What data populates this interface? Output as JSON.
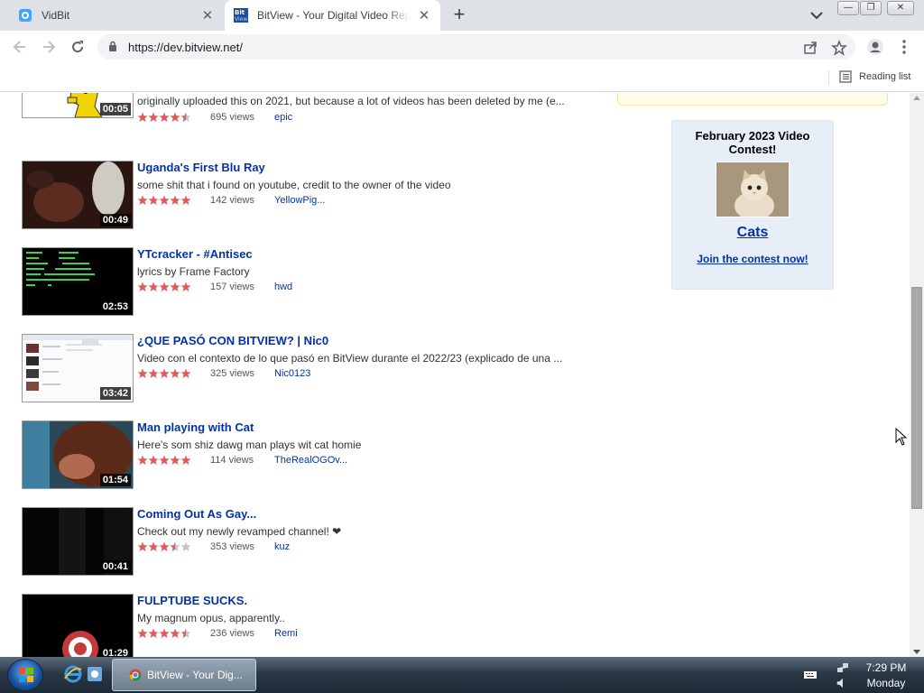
{
  "browser": {
    "tabs": [
      {
        "title": "VidBit",
        "active": false
      },
      {
        "title": "BitView - Your Digital Video Repository",
        "active": true
      }
    ],
    "url": "https://dev.bitview.net/",
    "reading_list_label": "Reading list",
    "icons": {
      "back": "arrow-left-icon",
      "forward": "arrow-right-icon",
      "reload": "reload-icon",
      "lock": "lock-icon",
      "share": "share-icon",
      "bookmark": "star-outline-icon",
      "profile": "avatar-icon",
      "menu": "kebab-menu-icon"
    }
  },
  "partial_video": {
    "description": "originally uploaded this on 2021, but because a lot of videos has been deleted by me (e...",
    "duration": "00:05",
    "views": "695 views",
    "author": "epic",
    "rating": 4.5
  },
  "videos": [
    {
      "title": "Uganda's First Blu Ray",
      "description": "some shit that i found on youtube, credit to the owner of the video",
      "duration": "00:49",
      "views": "142 views",
      "author": "YellowPig...",
      "rating": 5
    },
    {
      "title": "YTcracker - #Antisec",
      "description": "lyrics by Frame Factory",
      "duration": "02:53",
      "views": "157 views",
      "author": "hwd",
      "rating": 5
    },
    {
      "title": "¿QUE PASÓ CON BITVIEW? | Nic0",
      "description": "Video con el contexto de lo que pasó en BitView durante el 2022/23 (explicado de una ...",
      "duration": "03:42",
      "views": "325 views",
      "author": "Nic0123",
      "rating": 5
    },
    {
      "title": "Man playing with Cat",
      "description": "Here's som shiz dawg man plays wit cat homie",
      "duration": "01:54",
      "views": "114 views",
      "author": "TheRealOGOv...",
      "rating": 5
    },
    {
      "title": "Coming Out As Gay...",
      "description": "Check out my newly revamped channel! ❤",
      "duration": "00:41",
      "views": "353 views",
      "author": "kuz",
      "rating": 3.5
    },
    {
      "title": "FULPTUBE SUCKS.",
      "description": "My magnum opus, apparently..",
      "duration": "01:29",
      "views": "236 views",
      "author": "Remi",
      "rating": 4.5
    }
  ],
  "contest": {
    "title": "February 2023 Video Contest!",
    "theme": "Cats",
    "join_label": "Join the contest now!"
  },
  "taskbar": {
    "task_label": "BitView - Your Dig...",
    "time": "7:29 PM",
    "day": "Monday"
  },
  "colors": {
    "link": "#0033aa",
    "star": "#e05a5a",
    "contest_bg": "#e8eef8"
  }
}
